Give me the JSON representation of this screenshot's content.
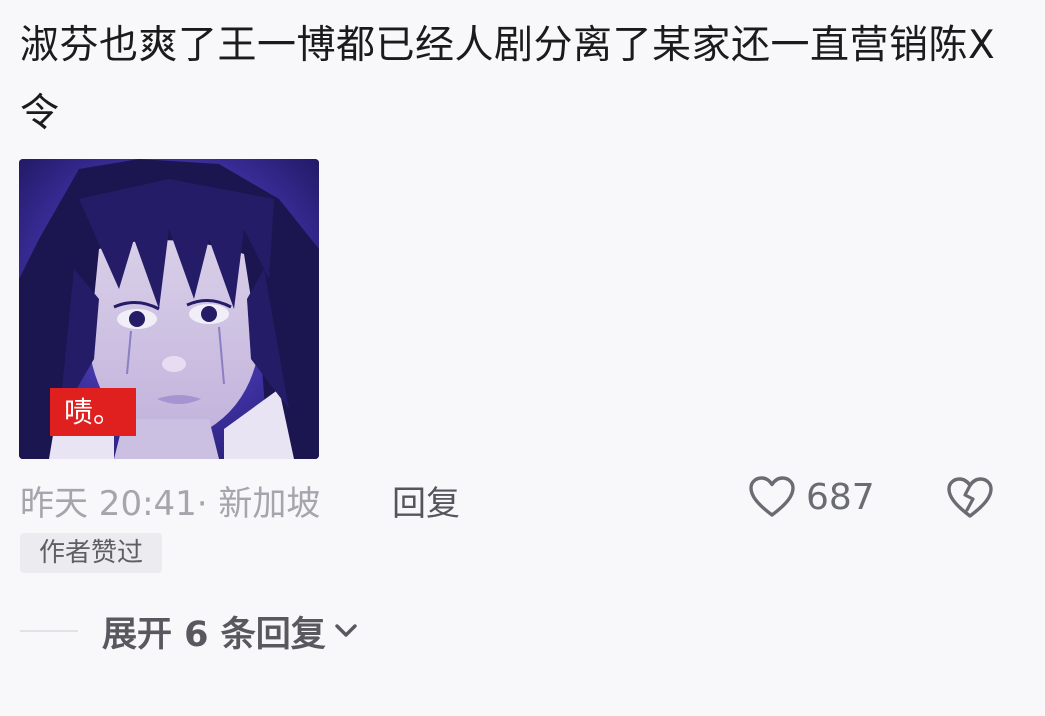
{
  "comment": {
    "text": "淑芬也爽了王一博都已经人剧分离了某家还一直营销陈X令",
    "image_caption": "啧。",
    "time_location": "昨天 20:41· 新加坡",
    "reply_label": "回复",
    "like_count": "687",
    "author_badge": "作者赞过",
    "expand_label": "展开 6 条回复"
  },
  "icons": {
    "like": "heart-outline-icon",
    "dislike": "broken-heart-icon",
    "expand": "chevron-down-icon"
  },
  "colors": {
    "caption_bg": "#e0201f",
    "meta_text": "#a5a5ab",
    "body_text": "#1b1b1b"
  }
}
